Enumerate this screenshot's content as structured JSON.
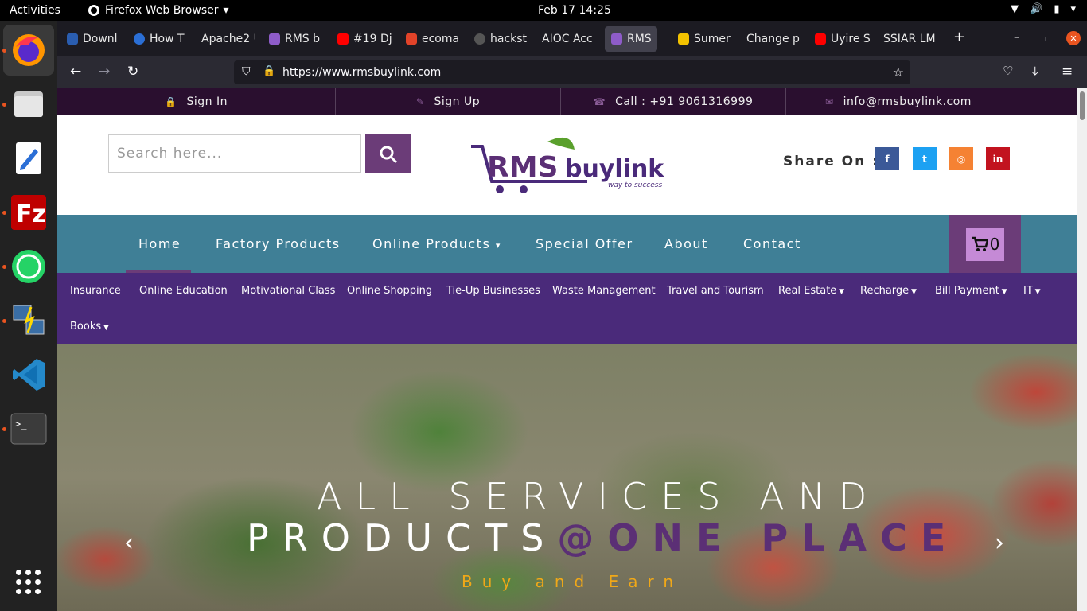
{
  "os": {
    "activities": "Activities",
    "app_name": "Firefox Web Browser",
    "clock": "Feb 17  14:25"
  },
  "tabs": [
    {
      "label": "Downl",
      "color": "#2a5db0"
    },
    {
      "label": "How T",
      "color": "#2b6fd6"
    },
    {
      "label": "Apache2 U",
      "color": "#1c1b22"
    },
    {
      "label": "RMS b",
      "color": "#8e5cc9"
    },
    {
      "label": "#19 Dj",
      "color": "#ff0000"
    },
    {
      "label": "ecoma",
      "color": "#e24329"
    },
    {
      "label": "hackst",
      "color": "#555555"
    },
    {
      "label": "AIOC Acc",
      "color": "#1c1b22"
    },
    {
      "label": "RMS",
      "color": "#8e5cc9"
    },
    {
      "label": "Sumer",
      "color": "#f2c200"
    },
    {
      "label": "Change p",
      "color": "#1c1b22"
    },
    {
      "label": "Uyire S",
      "color": "#ff0000"
    },
    {
      "label": "SSIAR LM",
      "color": "#1c1b22"
    }
  ],
  "browser": {
    "url": "https://www.rmsbuylink.com",
    "new_tab": "+"
  },
  "site": {
    "topbar": {
      "sign_in": "Sign In",
      "sign_up": "Sign Up",
      "call": "Call : +91 9061316999",
      "email": "info@rmsbuylink.com"
    },
    "search_placeholder": "Search here...",
    "logo": {
      "rms": "RMS",
      "buylink": "buylink",
      "tagline": "way to success"
    },
    "share_label": "Share On :",
    "social": [
      {
        "name": "facebook",
        "glyph": "f",
        "color": "#3b5998"
      },
      {
        "name": "twitter",
        "glyph": "t",
        "color": "#1da1f2"
      },
      {
        "name": "instagram",
        "glyph": "◎",
        "color": "#f58233"
      },
      {
        "name": "linkedin",
        "glyph": "in",
        "color": "#c2131f"
      }
    ],
    "main_nav": [
      "Home",
      "Factory Products",
      "Online Products",
      "Special Offer",
      "About",
      "Contact"
    ],
    "cart_count": "0",
    "sub_nav": [
      "Insurance",
      "Online Education",
      "Motivational Class",
      "Online Shopping",
      "Tie-Up Businesses",
      "Waste Management",
      "Travel and Tourism",
      "Real Estate",
      "Recharge",
      "Bill Payment",
      "IT",
      "Books"
    ],
    "hero": {
      "line1": "ALL SERVICES AND",
      "line2_white": "PRODUCTS",
      "line2_purple": "@ONE PLACE",
      "subtitle": "Buy and Earn"
    }
  }
}
